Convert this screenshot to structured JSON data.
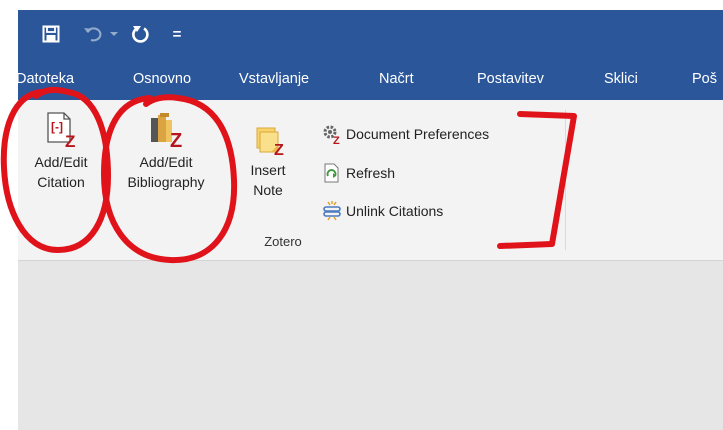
{
  "quick_access": {
    "items": [
      {
        "icon": "save-icon"
      },
      {
        "icon": "undo-icon"
      },
      {
        "icon": "dropdown-arrow-icon"
      },
      {
        "icon": "redo-icon"
      },
      {
        "icon": "customize-icon",
        "label": "="
      }
    ]
  },
  "tabs": [
    {
      "label": "Datoteka"
    },
    {
      "label": "Osnovno"
    },
    {
      "label": "Vstavljanje"
    },
    {
      "label": "Načrt"
    },
    {
      "label": "Postavitev"
    },
    {
      "label": "Sklici"
    },
    {
      "label": "Poš"
    }
  ],
  "zotero": {
    "add_edit_citation": {
      "line1": "Add/Edit",
      "line2": "Citation"
    },
    "add_edit_bibliography": {
      "line1": "Add/Edit",
      "line2": "Bibliography"
    },
    "insert_note": {
      "line1": "Insert",
      "line2": "Note"
    },
    "document_preferences": "Document Preferences",
    "refresh": "Refresh",
    "unlink_citations": "Unlink Citations",
    "group_label": "Zotero"
  },
  "colors": {
    "title_bar": "#2b579a",
    "ribbon": "#f3f3f3",
    "document_area": "#e6e6e6",
    "annotation": "#e0131a",
    "zotero_red": "#b5161c"
  }
}
